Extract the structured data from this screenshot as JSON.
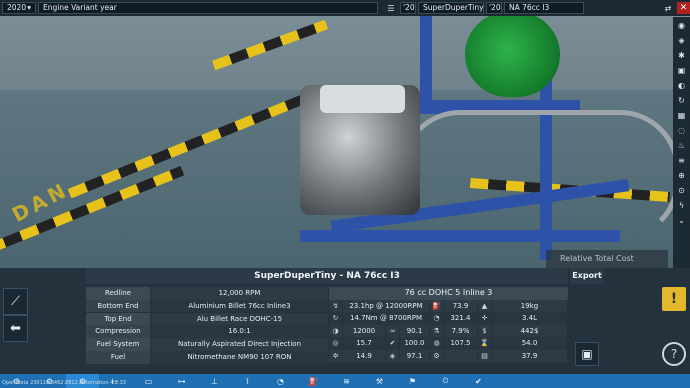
{
  "topbar": {
    "year": "2020",
    "variant_year_label": "Engine Variant year",
    "year_short_1": "'20",
    "family_name": "SuperDuperTiny",
    "year_short_2": "'20",
    "variant_name": "NA 76cc I3",
    "close_label": "✕"
  },
  "scene": {
    "floor_text": "DAN",
    "relative_cost_label": "Relative Total Cost"
  },
  "panel": {
    "title": "SuperDuperTiny - NA 76cc I3",
    "export_label": "Export",
    "warning_glyph": "!",
    "specs": [
      {
        "label": "Redline",
        "value": "12,000 RPM"
      },
      {
        "label": "Bottom End",
        "value": "Aluminium Billet 76cc Inline3"
      },
      {
        "label": "Top End",
        "value": "Alu Billet Race DOHC-15"
      },
      {
        "label": "Compression",
        "value": "16.0:1"
      },
      {
        "label": "Fuel System",
        "value": "Naturally Aspirated Direct Injection"
      },
      {
        "label": "Fuel",
        "value": "Nitromethane NM90 107 RON"
      }
    ],
    "perf_header": "76 cc DOHC 5  Inline 3",
    "perf_rows": [
      {
        "v1": "23.1hp @ 12000RPM",
        "v2": "",
        "v3": "73.9",
        "v4": "",
        "v5": "19kg"
      },
      {
        "v1": "14.7Nm @ 8700RPM",
        "v2": "",
        "v3": "321.4",
        "v4": "",
        "v5": "3.4L"
      },
      {
        "v1": "12000",
        "v2": "90.1",
        "v3": "7.9%",
        "v4": "",
        "v5": "442$"
      },
      {
        "v1": "15.7",
        "v2": "100.0",
        "v3": "107.5",
        "v4": "",
        "v5": "54.0"
      },
      {
        "v1": "14.9",
        "v2": "97.1",
        "v3": "",
        "v4": "",
        "v5": "37.9"
      }
    ]
  },
  "footer": {
    "build_text": "Open Beta  230110.3462.8812 Automation  4.2.33",
    "tabs": [
      "engine-icon",
      "cylinder-icon",
      "crank-icon",
      "piston-icon",
      "head-icon",
      "cam-icon",
      "valve-icon",
      "intake-icon",
      "turbo-icon",
      "fuel-icon",
      "exhaust-icon",
      "tune-icon",
      "test-icon",
      "dyno-icon",
      "check-icon"
    ]
  },
  "colors": {
    "accent": "#1f6fb3",
    "warning": "#e3b82a",
    "close": "#b32020",
    "dyno": "#1e9a3a",
    "frame": "#2d52a8"
  }
}
